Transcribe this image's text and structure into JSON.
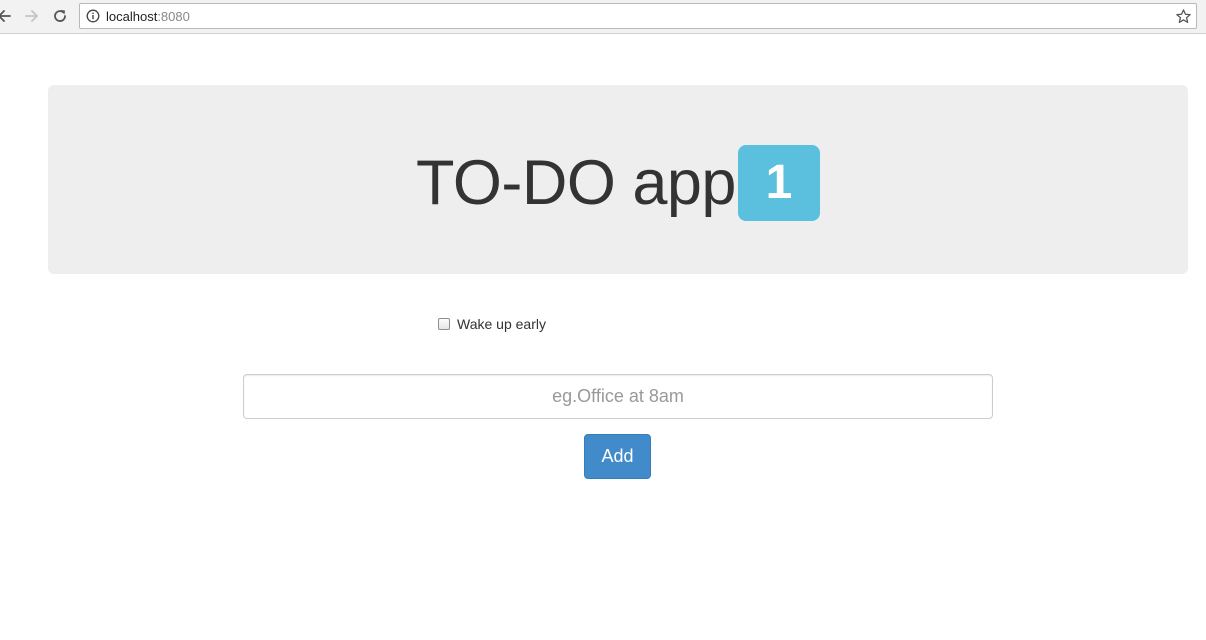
{
  "browser": {
    "url_host": "localhost",
    "url_port": ":8080"
  },
  "header": {
    "title": "TO-DO app",
    "badge_count": "1",
    "badge_color": "#5bc0de"
  },
  "todos": [
    {
      "label": "Wake up early",
      "checked": false
    }
  ],
  "new_todo": {
    "placeholder": "eg.Office at 8am",
    "value": ""
  },
  "add_button": {
    "label": "Add",
    "color": "#428bca"
  },
  "icons": {
    "back": "back-arrow-icon",
    "forward": "forward-arrow-icon",
    "reload": "reload-icon",
    "site_info": "info-icon",
    "bookmark": "star-icon"
  }
}
